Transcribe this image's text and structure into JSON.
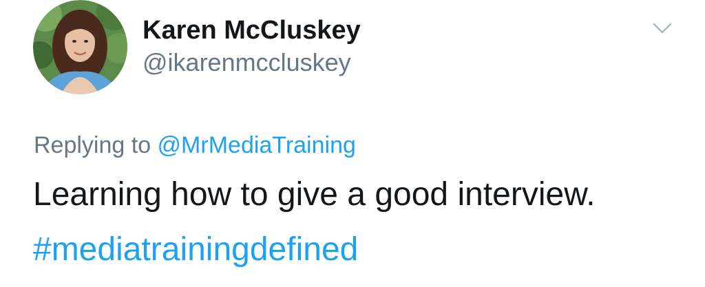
{
  "author": {
    "display_name": "Karen McCluskey",
    "handle": "@ikarenmccluskey",
    "avatar_icon": "profile-photo"
  },
  "reply": {
    "prefix": "Replying to ",
    "to_handle": "@MrMediaTraining"
  },
  "tweet": {
    "text": "Learning how to give a good interview.",
    "hashtag": "#mediatrainingdefined"
  },
  "menu": {
    "icon": "chevron-down-icon"
  },
  "colors": {
    "link": "#1da1f2",
    "text": "#14171a",
    "secondary": "#657786",
    "caret": "#aab8c2"
  }
}
